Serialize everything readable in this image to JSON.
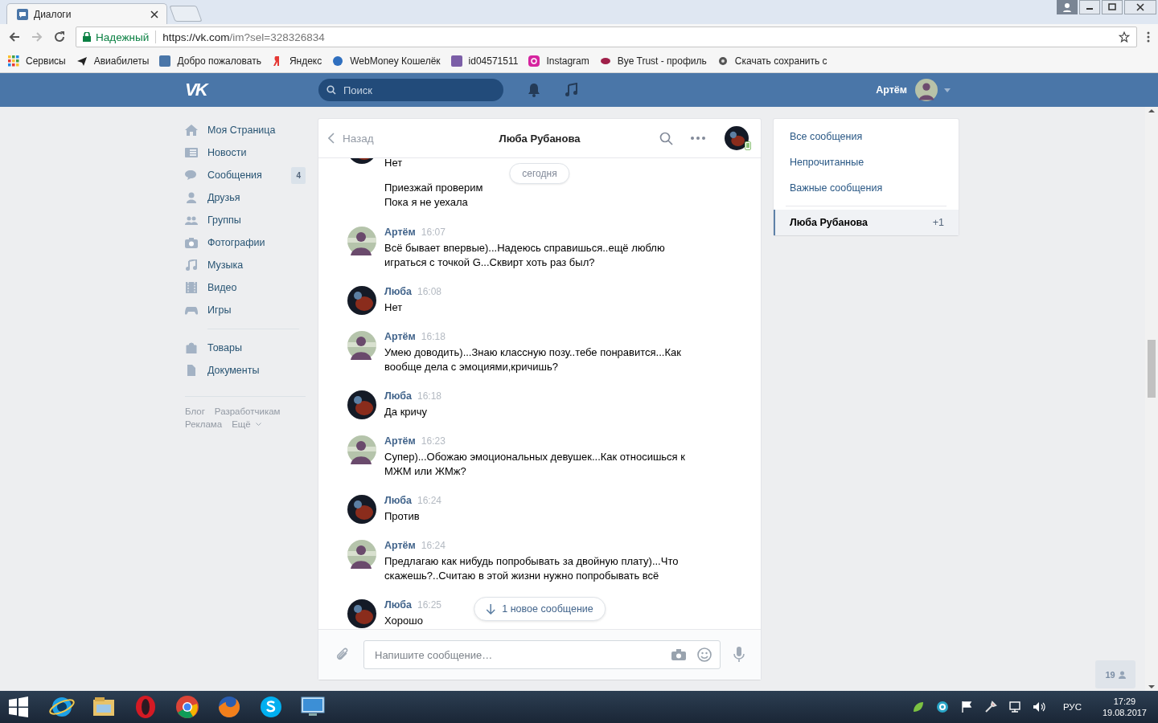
{
  "browser": {
    "tabs": [
      {
        "label": "Диалоги",
        "selected": true
      }
    ],
    "security": "Надежный",
    "url_host": "https://vk.com",
    "url_path": "/im?sel=328326834",
    "bookmarks": [
      {
        "label": "Сервисы"
      },
      {
        "label": "Авиабилеты"
      },
      {
        "label": "Добро пожаловать"
      },
      {
        "label": "Яндекс"
      },
      {
        "label": "WebMoney Кошелёк"
      },
      {
        "label": "id04571511"
      },
      {
        "label": "Instagram"
      },
      {
        "label": "Bye Trust - профиль"
      },
      {
        "label": "Скачать сохранить с"
      }
    ]
  },
  "vk_header": {
    "logo": "VK",
    "search": {
      "placeholder": "Поиск"
    },
    "user": "Артём"
  },
  "sidebar": {
    "items": [
      {
        "label": "Моя Страница"
      },
      {
        "label": "Новости"
      },
      {
        "label": "Сообщения",
        "badge": "4"
      },
      {
        "label": "Друзья"
      },
      {
        "label": "Группы"
      },
      {
        "label": "Фотографии"
      },
      {
        "label": "Музыка"
      },
      {
        "label": "Видео"
      },
      {
        "label": "Игры"
      }
    ],
    "secondary": [
      {
        "label": "Товары"
      },
      {
        "label": "Документы"
      }
    ],
    "footer": [
      {
        "label": "Блог",
        "dropdown": false
      },
      {
        "label": "Разработчикам",
        "dropdown": false
      },
      {
        "label": "Реклама",
        "dropdown": false
      },
      {
        "label": "Ещё",
        "dropdown": true
      }
    ]
  },
  "chat": {
    "back": "Назад",
    "title": "Люба Рубанова",
    "peer_online_mobile": true,
    "date_pill": "сегодня",
    "new_messages": "1 новое сообщение",
    "composer": {
      "placeholder": "Напишите сообщение…"
    },
    "messages": [
      {
        "kind": "peer",
        "continued": false,
        "texts": [
          "Нет"
        ]
      },
      {
        "kind": "peer",
        "continued": true,
        "texts": [
          "Приезжай проверим",
          "Пока я не уехала"
        ]
      },
      {
        "kind": "own",
        "continued": false,
        "author": "Артём",
        "time": "16:07",
        "texts": [
          "Всё бывает впервые)...Надеюсь справишься..ещё люблю играться с точкой G...Сквирт хоть раз был?"
        ]
      },
      {
        "kind": "peer",
        "continued": false,
        "author": "Люба",
        "time": "16:08",
        "texts": [
          "Нет"
        ]
      },
      {
        "kind": "own",
        "continued": false,
        "author": "Артём",
        "time": "16:18",
        "texts": [
          "Умею доводить)...Знаю классную позу..тебе понравится...Как вообще дела с эмоциями,кричишь?"
        ]
      },
      {
        "kind": "peer",
        "continued": false,
        "author": "Люба",
        "time": "16:18",
        "texts": [
          "Да кричу"
        ]
      },
      {
        "kind": "own",
        "continued": false,
        "author": "Артём",
        "time": "16:23",
        "texts": [
          "Супер)...Обожаю эмоциональных девушек...Как относишься к МЖМ или ЖМж?"
        ]
      },
      {
        "kind": "peer",
        "continued": false,
        "author": "Люба",
        "time": "16:24",
        "texts": [
          "Против"
        ]
      },
      {
        "kind": "own",
        "continued": false,
        "author": "Артём",
        "time": "16:24",
        "texts": [
          "Предлагаю как нибудь попробывать за двойную плату)...Что скажешь?..Считаю в этой жизни нужно попробывать всё"
        ]
      },
      {
        "kind": "peer",
        "continued": false,
        "author": "Люба",
        "time": "16:25",
        "texts": [
          "Хорошо"
        ]
      }
    ]
  },
  "right_panel": {
    "filters": [
      {
        "label": "Все сообщения",
        "selected": false
      },
      {
        "label": "Непрочитанные",
        "selected": false
      },
      {
        "label": "Важные сообщения",
        "selected": false
      }
    ],
    "dialogs": [
      {
        "name": "Люба Рубанова",
        "count": "+1",
        "selected": true
      }
    ]
  },
  "friends_online": "19",
  "taskbar": {
    "language": "РУС",
    "time": "17:29",
    "date": "19.08.2017"
  }
}
